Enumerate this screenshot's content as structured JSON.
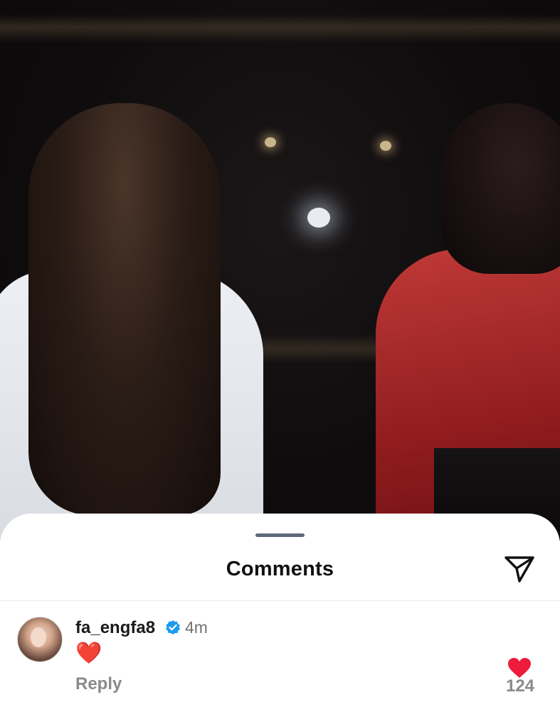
{
  "sheet": {
    "title": "Comments"
  },
  "comments": [
    {
      "username": "fa_engfa8",
      "time": "4m",
      "text": "❤️",
      "reply_label": "Reply",
      "like_count": "124"
    }
  ],
  "colors": {
    "verified": "#1d9bf0",
    "like": "#ed1c3b",
    "muted_text": "#8a8a8a"
  },
  "icons": {
    "share": "paper-plane-icon",
    "verified": "verified-badge-icon",
    "like": "heart-icon"
  }
}
